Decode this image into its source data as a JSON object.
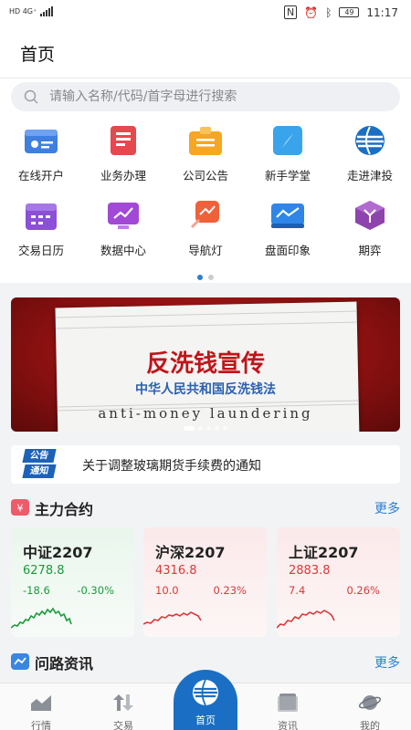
{
  "statusbar": {
    "network": "HD 4G⁺",
    "battery": "49",
    "time": "11:17"
  },
  "header": {
    "title": "首页"
  },
  "search": {
    "placeholder": "请输入名称/代码/首字母进行搜索"
  },
  "grid": {
    "items": [
      {
        "label": "在线开户",
        "icon": "id-card-icon"
      },
      {
        "label": "业务办理",
        "icon": "notebook-icon"
      },
      {
        "label": "公司公告",
        "icon": "announcement-icon"
      },
      {
        "label": "新手学堂",
        "icon": "compass-icon"
      },
      {
        "label": "走进津投",
        "icon": "company-logo-icon"
      },
      {
        "label": "交易日历",
        "icon": "calendar-icon"
      },
      {
        "label": "数据中心",
        "icon": "data-monitor-icon"
      },
      {
        "label": "导航灯",
        "icon": "guide-lamp-icon"
      },
      {
        "label": "盘面印象",
        "icon": "market-chart-icon"
      },
      {
        "label": "期弈",
        "icon": "cube-icon"
      }
    ],
    "page_indicator": {
      "current": 1,
      "total": 2
    }
  },
  "banner": {
    "title": "反洗钱宣传",
    "subtitle": "中华人民共和国反洗钱法",
    "english": "anti-money laundering",
    "carousel": {
      "current": 1,
      "total": 5
    }
  },
  "notice": {
    "badge_top": "公告",
    "badge_bottom": "通知",
    "text": "关于调整玻璃期货手续费的通知"
  },
  "main_contracts": {
    "title": "主力合约",
    "more": "更多",
    "cards": [
      {
        "name": "中证2207",
        "price": "6278.8",
        "change": "-18.6",
        "pct": "-0.30%",
        "trend": "down"
      },
      {
        "name": "沪深2207",
        "price": "4316.8",
        "change": "10.0",
        "pct": "0.23%",
        "trend": "up"
      },
      {
        "name": "上证2207",
        "price": "2883.8",
        "change": "7.4",
        "pct": "0.26%",
        "trend": "up"
      }
    ]
  },
  "news": {
    "title": "问路资讯",
    "more": "更多"
  },
  "tabbar": {
    "items": [
      {
        "label": "行情",
        "icon": "market-icon"
      },
      {
        "label": "交易",
        "icon": "trade-icon"
      },
      {
        "label": "首页",
        "icon": "home-logo-icon"
      },
      {
        "label": "资讯",
        "icon": "news-icon"
      },
      {
        "label": "我的",
        "icon": "profile-planet-icon"
      }
    ],
    "active": "首页"
  },
  "colors": {
    "accent": "#2a7fd4",
    "up": "#d83a3a",
    "down": "#1a9a3a",
    "banner": "#9b1414"
  }
}
